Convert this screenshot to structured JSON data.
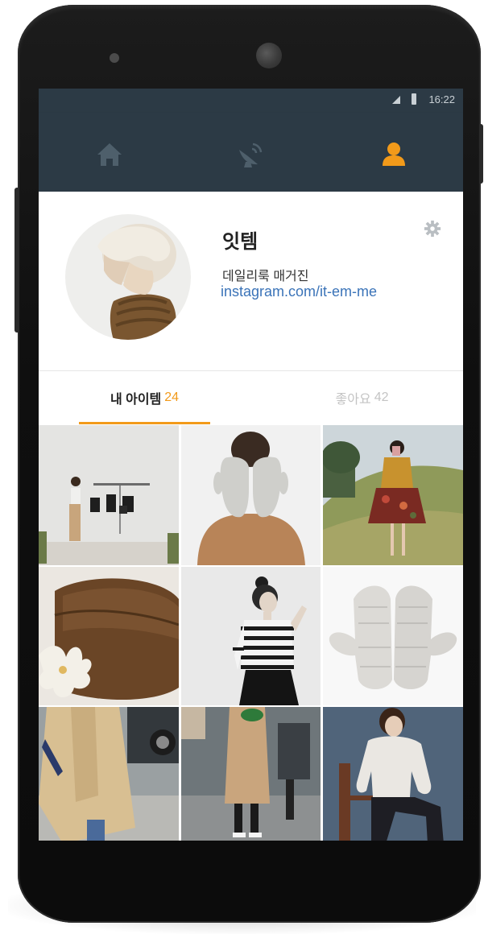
{
  "status_bar": {
    "time": "16:22"
  },
  "nav": {
    "items": [
      {
        "icon": "home-icon",
        "active": false
      },
      {
        "icon": "satellite-dish-icon",
        "active": false
      },
      {
        "icon": "user-icon",
        "active": true
      }
    ],
    "active_color": "#f29a1a",
    "inactive_color": "#4e5f6b"
  },
  "profile": {
    "name": "잇템",
    "description": "데일리룩 매거진",
    "link": "instagram.com/it-em-me"
  },
  "tabs": [
    {
      "label": "내 아이템",
      "count": "24",
      "active": true
    },
    {
      "label": "좋아요",
      "count": "42",
      "active": false
    }
  ],
  "grid": {
    "items": [
      {
        "image": "woman-with-hanging-bags"
      },
      {
        "image": "face-covered-with-mittens"
      },
      {
        "image": "woman-on-hill-floral-skirt"
      },
      {
        "image": "suede-clutch-with-lily"
      },
      {
        "image": "woman-striped-top"
      },
      {
        "image": "knit-mittens"
      },
      {
        "image": "teddy-coat-street"
      },
      {
        "image": "camel-coat-street"
      },
      {
        "image": "woman-white-sweater-chair"
      }
    ]
  },
  "colors": {
    "app_bar": "#2c3a45",
    "accent": "#f29a1a",
    "link": "#3a73b8"
  }
}
